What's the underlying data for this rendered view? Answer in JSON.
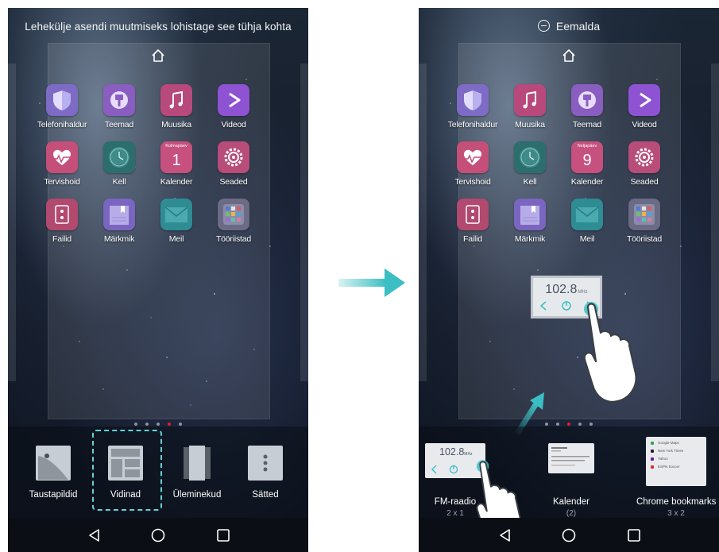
{
  "left_screen": {
    "hint": "Lehekülje asendi muutmiseks lohistage see tühja kohta",
    "apps": [
      {
        "label": "Telefonihaldur",
        "color": "#7d6bc6",
        "icon": "shield-icon"
      },
      {
        "label": "Teemad",
        "color": "#8a5ec0",
        "icon": "brush-icon"
      },
      {
        "label": "Muusika",
        "color": "#b8497c",
        "icon": "music-note-icon"
      },
      {
        "label": "Videod",
        "color": "#8e53d2",
        "icon": "play-icon"
      },
      {
        "label": "Tervishoid",
        "color": "#c44f79",
        "icon": "heart-pulse-icon"
      },
      {
        "label": "Kell",
        "color": "#2c6e6e",
        "icon": "clock-icon"
      },
      {
        "label": "Kalender",
        "color": "#c6507e",
        "icon": "calendar-icon",
        "day": "Kolmapäev",
        "date": "1"
      },
      {
        "label": "Seaded",
        "color": "#b84d79",
        "icon": "gear-icon"
      },
      {
        "label": "Failid",
        "color": "#b2496e",
        "icon": "folder-icon"
      },
      {
        "label": "Märkmik",
        "color": "#7a66c0",
        "icon": "notebook-icon"
      },
      {
        "label": "Meil",
        "color": "#2f8c92",
        "icon": "mail-icon"
      },
      {
        "label": "Tööriistad",
        "color": "#6b6b85",
        "icon": "tools-folder-icon"
      }
    ],
    "options": [
      {
        "label": "Taustapildid",
        "icon": "wallpaper-icon"
      },
      {
        "label": "Vidinad",
        "icon": "widgets-icon"
      },
      {
        "label": "Üleminekud",
        "icon": "transitions-icon"
      },
      {
        "label": "Sätted",
        "icon": "settings-dots-icon"
      }
    ]
  },
  "right_screen": {
    "remove_label": "Eemalda",
    "apps": [
      {
        "label": "Telefonihaldur",
        "color": "#7d6bc6",
        "icon": "shield-icon"
      },
      {
        "label": "Muusika",
        "color": "#b8497c",
        "icon": "music-note-icon"
      },
      {
        "label": "Teemad",
        "color": "#8a5ec0",
        "icon": "brush-icon"
      },
      {
        "label": "Videod",
        "color": "#8e53d2",
        "icon": "play-icon"
      },
      {
        "label": "Tervishoid",
        "color": "#c44f79",
        "icon": "heart-pulse-icon"
      },
      {
        "label": "Kell",
        "color": "#2c6e6e",
        "icon": "clock-icon"
      },
      {
        "label": "Kalender",
        "color": "#c6507e",
        "icon": "calendar-icon",
        "day": "Neljapäev",
        "date": "9"
      },
      {
        "label": "Seaded",
        "color": "#b84d79",
        "icon": "gear-icon"
      },
      {
        "label": "Failid",
        "color": "#b2496e",
        "icon": "folder-icon"
      },
      {
        "label": "Märkmik",
        "color": "#7a66c0",
        "icon": "notebook-icon"
      },
      {
        "label": "Meil",
        "color": "#2f8c92",
        "icon": "mail-icon"
      },
      {
        "label": "Tööriistad",
        "color": "#6b6b85",
        "icon": "tools-folder-icon"
      }
    ],
    "radio_widget": {
      "frequency": "102.8",
      "unit": "MHz"
    },
    "widgets": [
      {
        "title": "FM-raadio",
        "sub": "2 x 1",
        "freq": "102.8",
        "unit": "MHz"
      },
      {
        "title": "Kalender",
        "sub": "(2)"
      },
      {
        "title": "Chrome bookmarks",
        "sub": "3 x 2",
        "items": [
          "Google Maps",
          "New York Times",
          "Yahoo",
          "ESPN Soccer"
        ]
      }
    ]
  },
  "colors": {
    "accent_teal": "#3bbfc4",
    "page_dot_active": "#e0202e",
    "dash": "#62d3d6"
  }
}
